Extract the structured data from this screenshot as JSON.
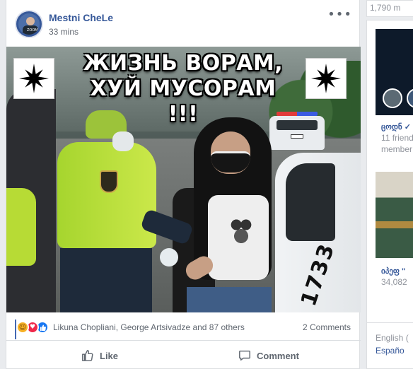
{
  "post": {
    "author": "Mestni CheLe",
    "timestamp": "33 mins",
    "more_label": "•••",
    "avatar_caption": "ZOOM",
    "image": {
      "meme_text": "ЖИЗНЬ ВОРАМ, ХУЙ МУСОРАМ !!!",
      "car_number": "1733"
    },
    "reactions": {
      "icons": [
        "haha-icon",
        "love-icon",
        "like-icon"
      ],
      "names": "Likuna Chopliani, George Artsivadze and 87 others",
      "comments": "2 Comments"
    },
    "actions": {
      "like_label": "Like",
      "comment_label": "Comment"
    }
  },
  "sidebar": {
    "top_text": "1,790 m",
    "groups": [
      {
        "name": "ცოდნ ✓",
        "subtitle": "11 friend\nmember"
      },
      {
        "name": "იპეფ \"",
        "subtitle": "34,082"
      }
    ],
    "languages": [
      "English (",
      "Españo"
    ]
  },
  "colors": {
    "link": "#365899",
    "background": "#e9ebee",
    "like_blue": "#1877f2"
  }
}
